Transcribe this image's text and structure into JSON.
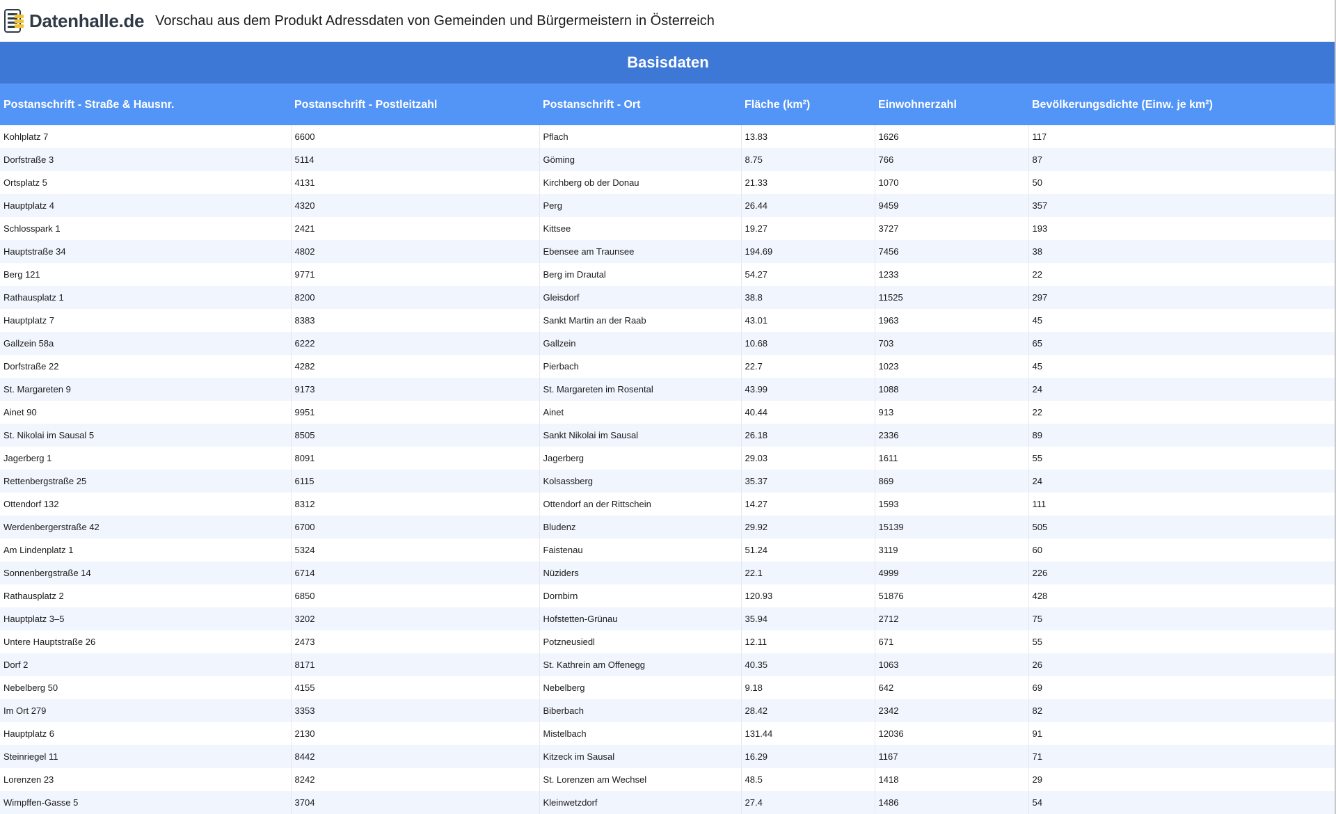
{
  "header": {
    "logo_text": "Datenhalle.de",
    "logo_icon": "database-stack-icon",
    "title": "Vorschau aus dem Produkt Adressdaten von Gemeinden und Bürgermeistern in Österreich"
  },
  "colors": {
    "section_header_bg": "#3d78d6",
    "table_header_bg": "#5394f7",
    "row_alt_bg": "#f1f5fd"
  },
  "section": {
    "title": "Basisdaten"
  },
  "table": {
    "columns": [
      "Postanschrift - Straße & Hausnr.",
      "Postanschrift - Postleitzahl",
      "Postanschrift - Ort",
      "Fläche (km²)",
      "Einwohnerzahl",
      "Bevölkerungsdichte (Einw. je km²)"
    ],
    "rows": [
      [
        "Kohlplatz 7",
        "6600",
        "Pflach",
        "13.83",
        "1626",
        "117"
      ],
      [
        "Dorfstraße 3",
        "5114",
        "Göming",
        "8.75",
        "766",
        "87"
      ],
      [
        "Ortsplatz 5",
        "4131",
        "Kirchberg ob der Donau",
        "21.33",
        "1070",
        "50"
      ],
      [
        "Hauptplatz 4",
        "4320",
        "Perg",
        "26.44",
        "9459",
        "357"
      ],
      [
        "Schlosspark 1",
        "2421",
        "Kittsee",
        "19.27",
        "3727",
        "193"
      ],
      [
        "Hauptstraße 34",
        "4802",
        "Ebensee am Traunsee",
        "194.69",
        "7456",
        "38"
      ],
      [
        "Berg 121",
        "9771",
        "Berg im Drautal",
        "54.27",
        "1233",
        "22"
      ],
      [
        "Rathausplatz 1",
        "8200",
        "Gleisdorf",
        "38.8",
        "11525",
        "297"
      ],
      [
        "Hauptplatz 7",
        "8383",
        "Sankt Martin an der Raab",
        "43.01",
        "1963",
        "45"
      ],
      [
        "Gallzein 58a",
        "6222",
        "Gallzein",
        "10.68",
        "703",
        "65"
      ],
      [
        "Dorfstraße 22",
        "4282",
        "Pierbach",
        "22.7",
        "1023",
        "45"
      ],
      [
        "St. Margareten 9",
        "9173",
        "St. Margareten im Rosental",
        "43.99",
        "1088",
        "24"
      ],
      [
        "Ainet 90",
        "9951",
        "Ainet",
        "40.44",
        "913",
        "22"
      ],
      [
        "St. Nikolai im Sausal 5",
        "8505",
        "Sankt Nikolai im Sausal",
        "26.18",
        "2336",
        "89"
      ],
      [
        "Jagerberg 1",
        "8091",
        "Jagerberg",
        "29.03",
        "1611",
        "55"
      ],
      [
        "Rettenbergstraße 25",
        "6115",
        "Kolsassberg",
        "35.37",
        "869",
        "24"
      ],
      [
        "Ottendorf 132",
        "8312",
        "Ottendorf an der Rittschein",
        "14.27",
        "1593",
        "111"
      ],
      [
        "Werdenbergerstraße 42",
        "6700",
        "Bludenz",
        "29.92",
        "15139",
        "505"
      ],
      [
        "Am Lindenplatz 1",
        "5324",
        "Faistenau",
        "51.24",
        "3119",
        "60"
      ],
      [
        "Sonnenbergstraße 14",
        "6714",
        "Nüziders",
        "22.1",
        "4999",
        "226"
      ],
      [
        "Rathausplatz 2",
        "6850",
        "Dornbirn",
        "120.93",
        "51876",
        "428"
      ],
      [
        "Hauptplatz 3–5",
        "3202",
        "Hofstetten-Grünau",
        "35.94",
        "2712",
        "75"
      ],
      [
        "Untere Hauptstraße 26",
        "2473",
        "Potzneusiedl",
        "12.11",
        "671",
        "55"
      ],
      [
        "Dorf 2",
        "8171",
        "St. Kathrein am Offenegg",
        "40.35",
        "1063",
        "26"
      ],
      [
        "Nebelberg 50",
        "4155",
        "Nebelberg",
        "9.18",
        "642",
        "69"
      ],
      [
        "Im Ort 279",
        "3353",
        "Biberbach",
        "28.42",
        "2342",
        "82"
      ],
      [
        "Hauptplatz 6",
        "2130",
        "Mistelbach",
        "131.44",
        "12036",
        "91"
      ],
      [
        "Steinriegel 11",
        "8442",
        "Kitzeck im Sausal",
        "16.29",
        "1167",
        "71"
      ],
      [
        "Lorenzen 23",
        "8242",
        "St. Lorenzen am Wechsel",
        "48.5",
        "1418",
        "29"
      ],
      [
        "Wimpffen-Gasse 5",
        "3704",
        "Kleinwetzdorf",
        "27.4",
        "1486",
        "54"
      ]
    ]
  }
}
